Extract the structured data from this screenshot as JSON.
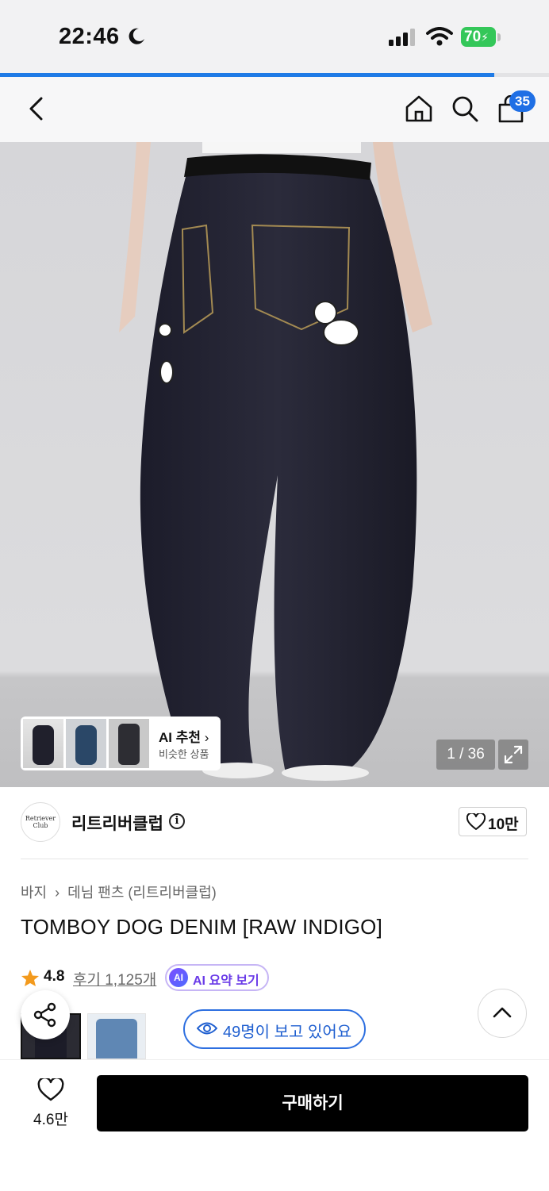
{
  "status_bar": {
    "time": "22:46",
    "battery": "70",
    "icons": [
      "moon-icon",
      "signal-icon",
      "wifi-icon",
      "battery-icon"
    ]
  },
  "page_progress": {
    "fraction": 0.9
  },
  "header": {
    "icons": [
      "back-icon",
      "home-icon",
      "search-icon",
      "cart-icon"
    ],
    "cart_count": "35"
  },
  "gallery": {
    "ai_recommend": {
      "title": "AI 추천",
      "subtitle": "비슷한 상품"
    },
    "counter": "1 / 36"
  },
  "brand": {
    "logo_text": "Retriever Club",
    "name": "리트리버클럽",
    "likes": "10만"
  },
  "product": {
    "breadcrumb": {
      "category": "바지",
      "subcategory": "데님 팬츠 (리트리버클럽)"
    },
    "title": "TOMBOY DOG DENIM [RAW INDIGO]",
    "rating": "4.8",
    "reviews": "후기 1,125개",
    "ai_summary_badge": "AI",
    "ai_summary_label": "AI 요약 보기",
    "viewing_now": "49명이 보고 있어요"
  },
  "bottom_bar": {
    "wish_count": "4.6만",
    "buy_label": "구매하기"
  },
  "colors": {
    "accent_blue": "#1f6fe5",
    "battery_green": "#34c759",
    "ai_purple": "#6a3be8",
    "buy_button": "#000000"
  }
}
